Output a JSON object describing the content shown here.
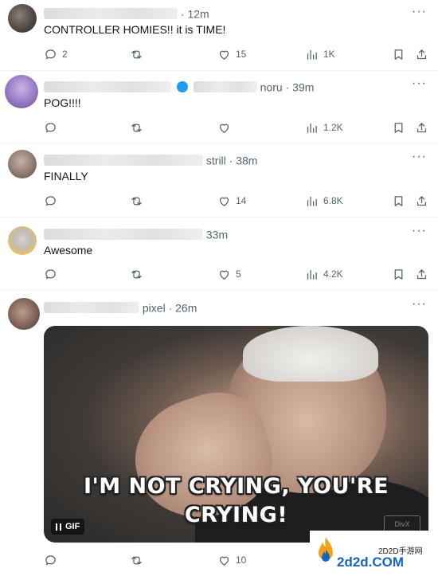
{
  "tweets": [
    {
      "time": "12m",
      "text": "CONTROLLER HOMIES!! it is TIME!",
      "stats": {
        "replies": "2",
        "retweets": "",
        "likes": "15",
        "views": "1K"
      }
    },
    {
      "handle_visible": "noru",
      "time": "39m",
      "text": "POG!!!!",
      "stats": {
        "replies": "",
        "retweets": "",
        "likes": "",
        "views": "1.2K"
      }
    },
    {
      "handle_visible": "strill",
      "time": "38m",
      "text": "FINALLY",
      "stats": {
        "replies": "",
        "retweets": "",
        "likes": "14",
        "views": "6.8K"
      }
    },
    {
      "time": "33m",
      "text": "Awesome",
      "stats": {
        "replies": "",
        "retweets": "",
        "likes": "5",
        "views": "4.2K"
      }
    },
    {
      "handle_visible": "pixel",
      "time": "26m",
      "media": {
        "caption_line1": "I'M NOT CRYING, YOU'RE",
        "caption_line2": "CRYING!",
        "badge": "GIF",
        "corner_logo": "DivX"
      },
      "stats": {
        "replies": "",
        "retweets": "",
        "likes": "10",
        "views": ""
      }
    }
  ],
  "separator": "·",
  "more_glyph": "···",
  "watermark": {
    "small": "2D2D手游网",
    "big": "2d2d.COM"
  },
  "colors": {
    "text": "#0f1419",
    "muted": "#536471",
    "verified": "#1d9bf0",
    "watermark_blue": "#1565c0"
  }
}
